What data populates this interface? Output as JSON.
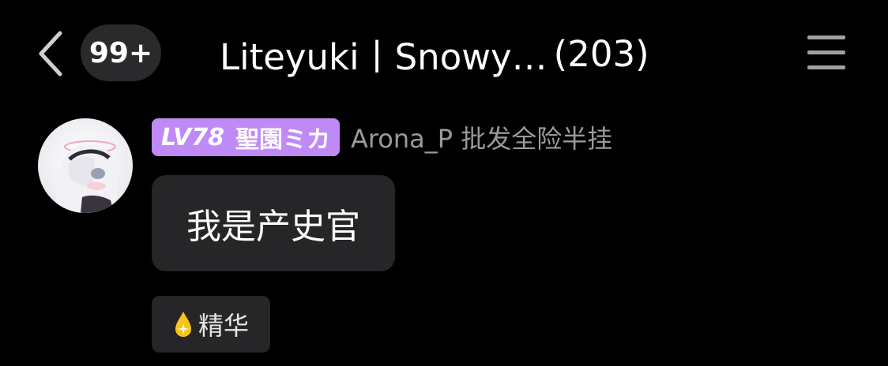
{
  "header": {
    "back_icon": "chevron-left-icon",
    "unread_count": "99+",
    "title": "Liteyuki丨Snowy…",
    "member_count": "(203)",
    "menu_icon": "hamburger-menu-icon"
  },
  "message": {
    "level": "LV78",
    "member_title": "聖園ミカ",
    "sender_name": "Arona_P 批发全险半挂",
    "text": "我是产史官",
    "tag_label": "精华",
    "tag_icon": "drop-icon"
  },
  "colors": {
    "background": "#000000",
    "bubble": "#262628",
    "badge": "#2a2a2c",
    "level_tag": "#bf8af6",
    "sender_name": "#9a9a9c",
    "essence_drop": "#f5c518"
  }
}
